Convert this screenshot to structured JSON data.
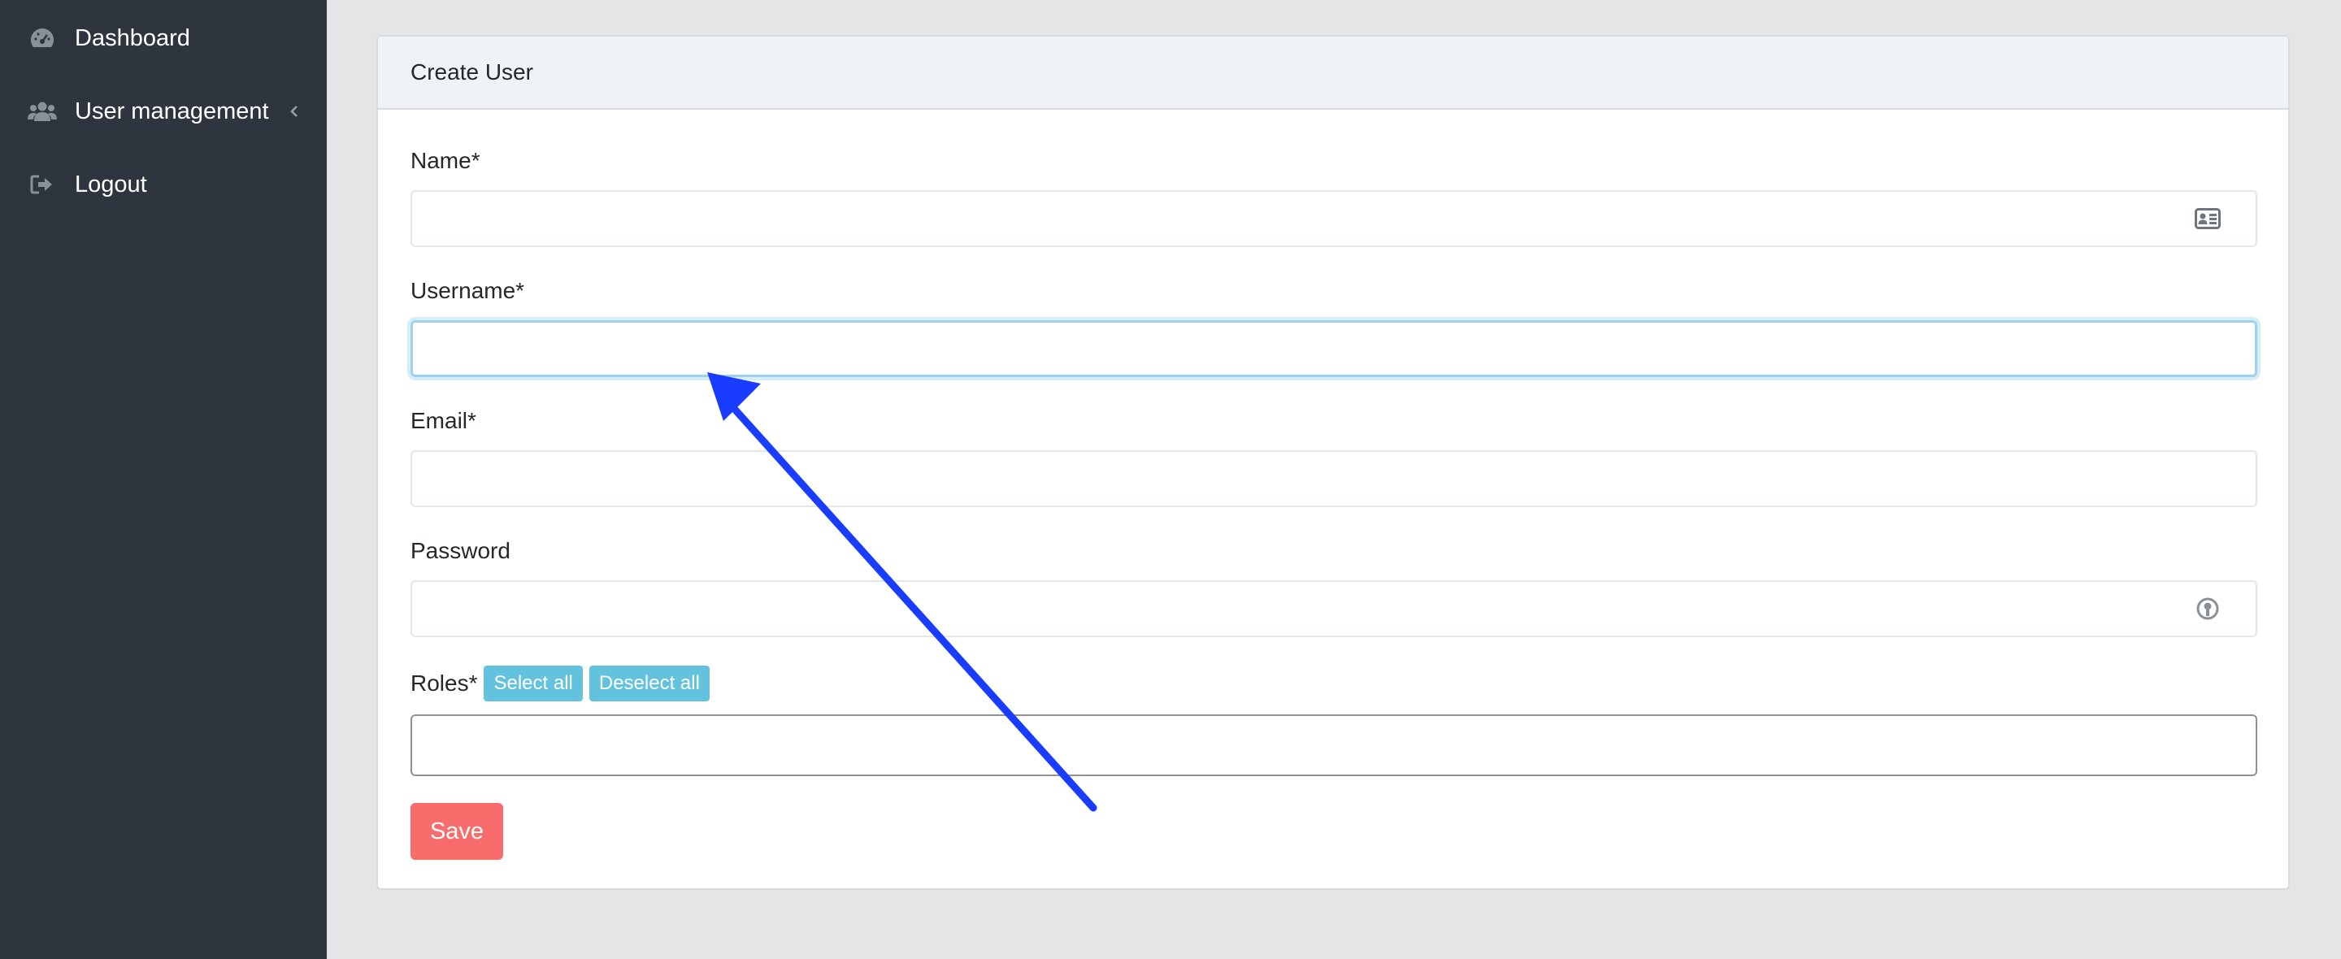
{
  "sidebar": {
    "items": [
      {
        "label": "Dashboard",
        "icon": "speedometer-icon"
      },
      {
        "label": "User management",
        "icon": "users-icon",
        "has_submenu": true
      },
      {
        "label": "Logout",
        "icon": "logout-icon"
      }
    ]
  },
  "card": {
    "title": "Create User"
  },
  "form": {
    "name_label": "Name*",
    "username_label": "Username*",
    "email_label": "Email*",
    "password_label": "Password",
    "roles_label": "Roles*",
    "select_all_label": "Select all",
    "deselect_all_label": "Deselect all",
    "save_label": "Save",
    "name_value": "",
    "username_value": "",
    "email_value": "",
    "password_value": ""
  },
  "colors": {
    "sidebar_bg": "#2f353e",
    "page_bg": "#e4e5e7",
    "info": "#63c2de",
    "danger": "#f86c6b",
    "annotation_arrow": "#1a3cff"
  }
}
